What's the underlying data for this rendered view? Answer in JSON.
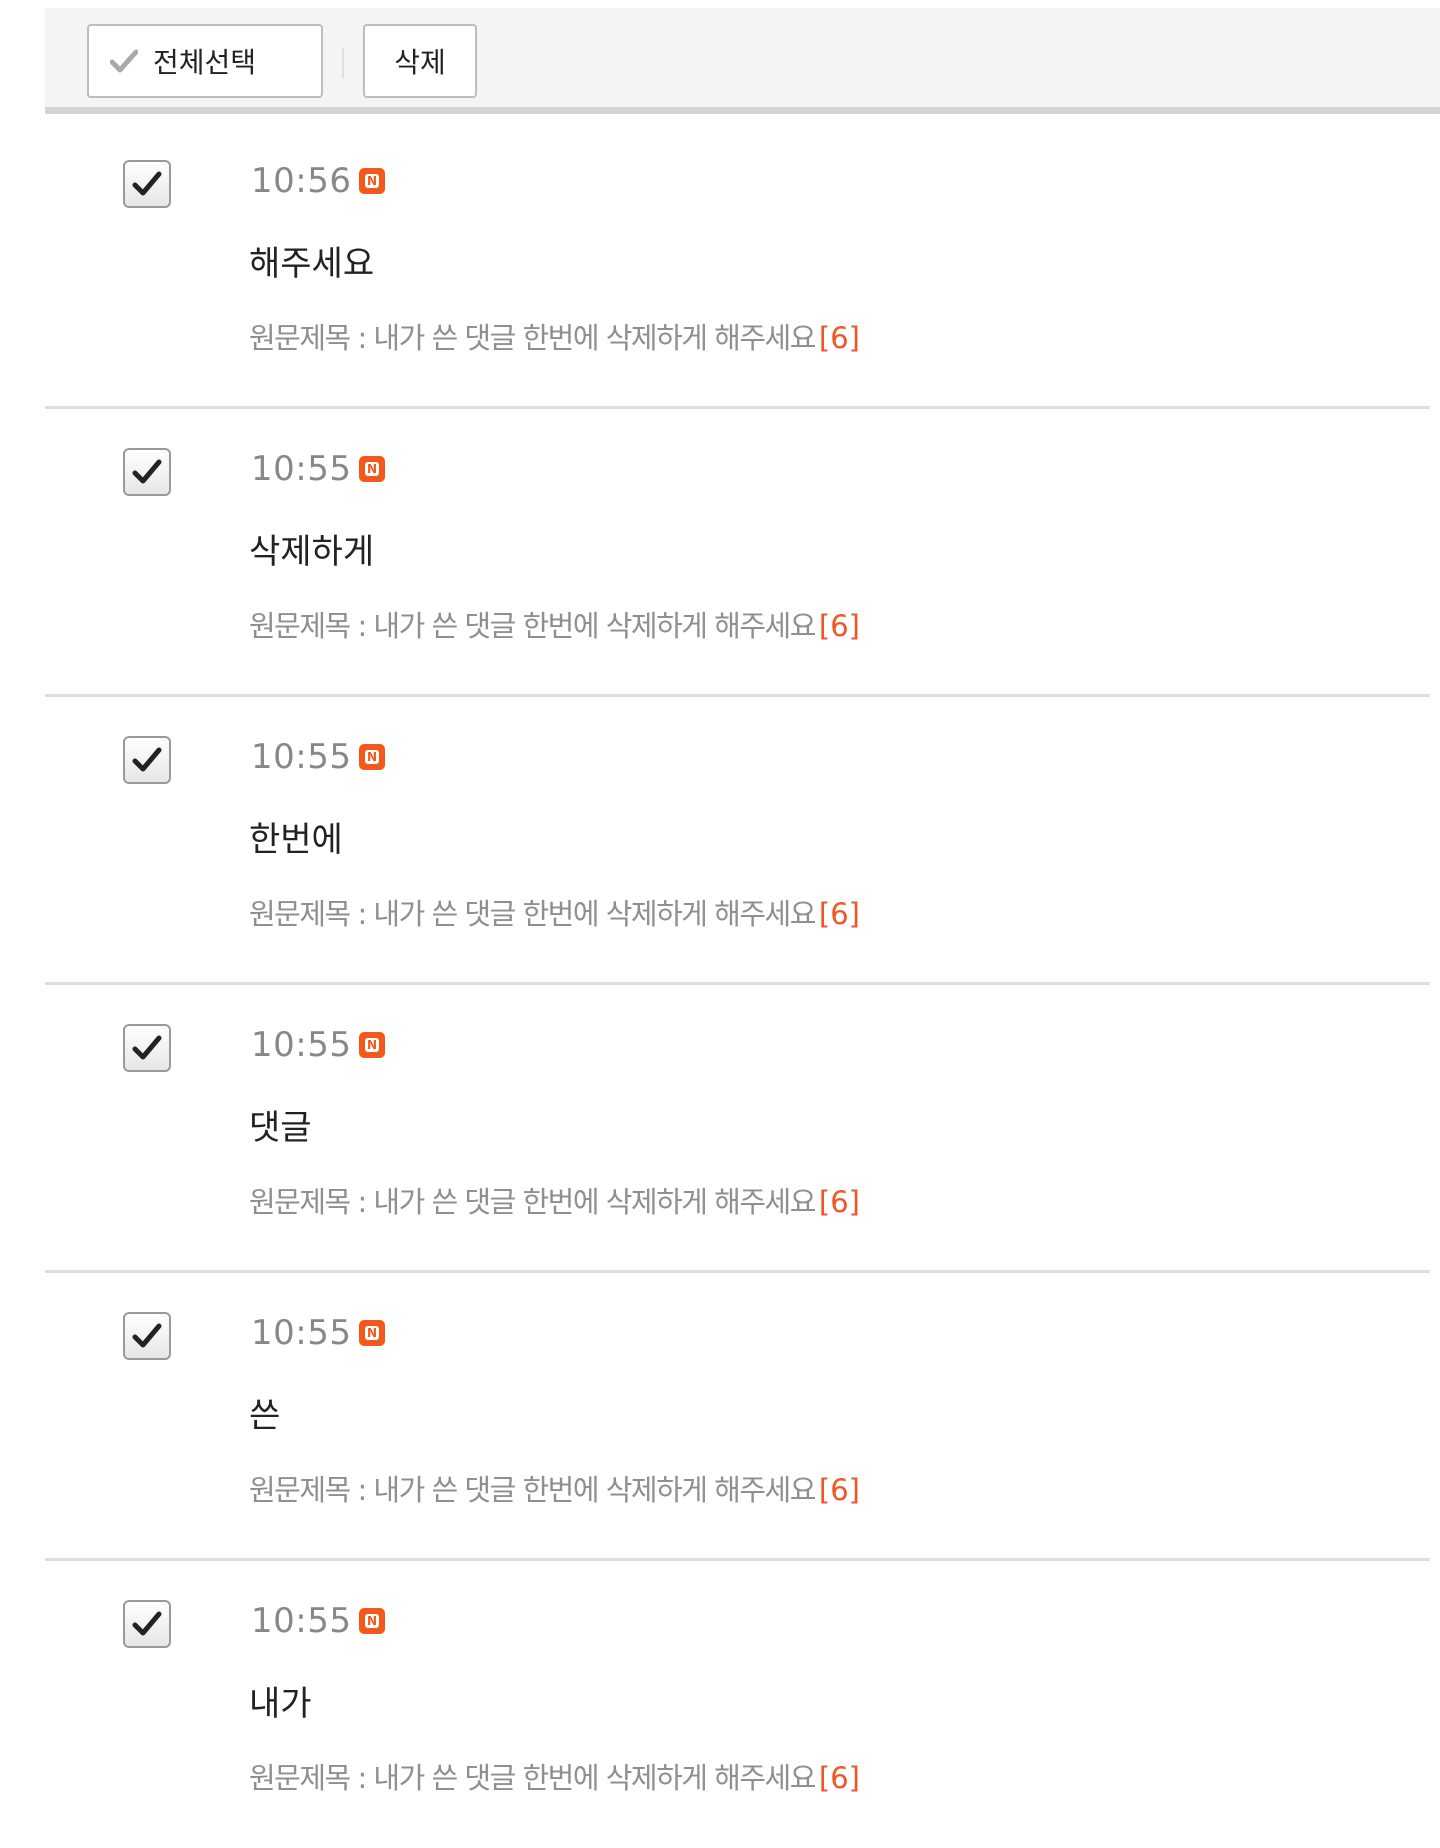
{
  "toolbar": {
    "select_all_label": "전체선택",
    "delete_label": "삭제"
  },
  "colors": {
    "accent": "#f25a1d",
    "count": "#f0552a",
    "toolbar_bg": "#f4f4f4",
    "divider": "#dedede"
  },
  "items": [
    {
      "time": "10:56",
      "badge": "N",
      "comment": "해주세요",
      "source_prefix": "원문제목 : 내가 쓴 댓글 한번에 삭제하게 해주세요",
      "count": "[6]",
      "checked": true
    },
    {
      "time": "10:55",
      "badge": "N",
      "comment": "삭제하게",
      "source_prefix": "원문제목 : 내가 쓴 댓글 한번에 삭제하게 해주세요",
      "count": "[6]",
      "checked": true
    },
    {
      "time": "10:55",
      "badge": "N",
      "comment": "한번에",
      "source_prefix": "원문제목 : 내가 쓴 댓글 한번에 삭제하게 해주세요",
      "count": "[6]",
      "checked": true
    },
    {
      "time": "10:55",
      "badge": "N",
      "comment": "댓글",
      "source_prefix": "원문제목 : 내가 쓴 댓글 한번에 삭제하게 해주세요",
      "count": "[6]",
      "checked": true
    },
    {
      "time": "10:55",
      "badge": "N",
      "comment": "쓴",
      "source_prefix": "원문제목 : 내가 쓴 댓글 한번에 삭제하게 해주세요",
      "count": "[6]",
      "checked": true
    },
    {
      "time": "10:55",
      "badge": "N",
      "comment": "내가",
      "source_prefix": "원문제목 : 내가 쓴 댓글 한번에 삭제하게 해주세요",
      "count": "[6]",
      "checked": true
    }
  ]
}
